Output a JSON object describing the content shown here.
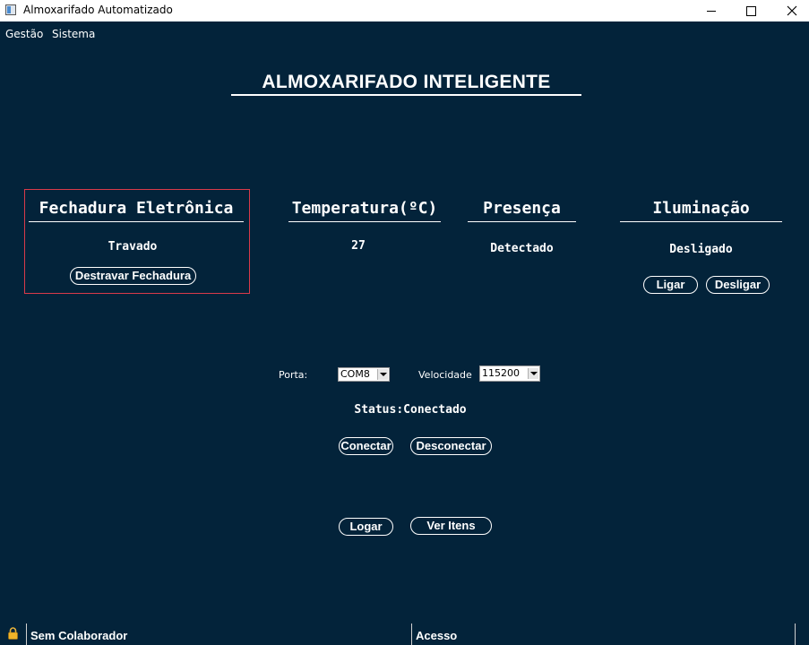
{
  "window": {
    "title": "Almoxarifado Automatizado"
  },
  "menu": {
    "items": [
      "Gestão",
      "Sistema"
    ]
  },
  "header": {
    "title": "ALMOXARIFADO INTELIGENTE"
  },
  "lock_panel": {
    "title": "Fechadura Eletrônica",
    "status": "Travado",
    "button": "Destravar Fechadura"
  },
  "temperature_panel": {
    "title": "Temperatura(ºC)",
    "value": "27"
  },
  "presence_panel": {
    "title": "Presença",
    "value": "Detectado"
  },
  "lighting_panel": {
    "title": "Iluminação",
    "status": "Desligado",
    "on_button": "Ligar",
    "off_button": "Desligar"
  },
  "connection": {
    "port_label": "Porta:",
    "port_value": "COM8",
    "speed_label": "Velocidade",
    "speed_value": "115200",
    "status": "Status:Conectado",
    "connect_button": "Conectar",
    "disconnect_button": "Desconectar"
  },
  "actions": {
    "login_button": "Logar",
    "items_button": "Ver Itens"
  },
  "statusbar": {
    "user": "Sem Colaborador",
    "access": "Acesso"
  },
  "colors": {
    "background": "#03233a",
    "frame_accent": "#d93a4a",
    "text": "#ffffff"
  },
  "icons": {
    "status_lock": "lock-icon"
  }
}
